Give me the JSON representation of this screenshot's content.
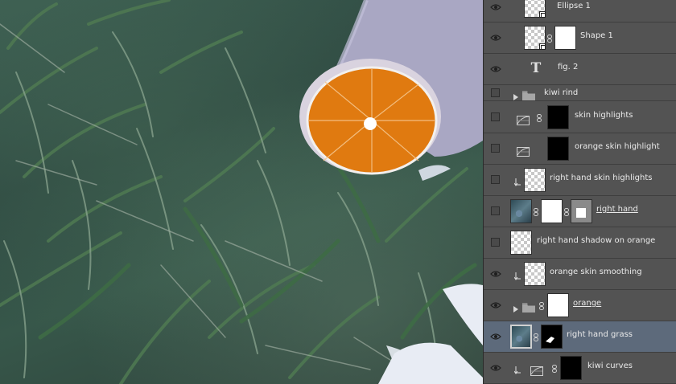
{
  "layers_panel": {
    "layers": [
      {
        "name": "Ellipse 1",
        "visible": true,
        "type": "shape",
        "icon": "shape-thumbnail-icon"
      },
      {
        "name": "Shape 1",
        "visible": true,
        "type": "shape-with-mask",
        "icon": "shape-thumbnail-icon"
      },
      {
        "name": "fig. 2",
        "visible": true,
        "type": "text",
        "icon": "text-layer-icon"
      },
      {
        "name": "kiwi rind",
        "visible": false,
        "type": "group",
        "icon": "folder-icon"
      },
      {
        "name": "skin highlights",
        "visible": false,
        "type": "adjustment",
        "icon": "curves-adjustment-icon"
      },
      {
        "name": "orange skin highlight",
        "visible": false,
        "type": "adjustment",
        "icon": "curves-adjustment-icon"
      },
      {
        "name": "right hand skin highlights",
        "visible": false,
        "type": "clipped-pixel",
        "icon": "clipping-arrow-icon"
      },
      {
        "name": "right hand",
        "visible": false,
        "type": "smart-object-with-masks",
        "icon": "photo-thumbnail-icon"
      },
      {
        "name": "right hand shadow on orange",
        "visible": false,
        "type": "pixel",
        "icon": "checker-thumbnail-icon"
      },
      {
        "name": "orange skin smoothing",
        "visible": true,
        "type": "clipped-pixel",
        "icon": "clipping-arrow-icon"
      },
      {
        "name": "orange",
        "visible": true,
        "type": "group-with-mask",
        "icon": "folder-icon"
      },
      {
        "name": "right hand grass",
        "visible": true,
        "type": "smart-object-with-mask",
        "selected": true,
        "icon": "photo-thumbnail-icon"
      },
      {
        "name": "kiwi curves",
        "visible": true,
        "type": "clipped-adjustment",
        "icon": "curves-adjustment-icon"
      }
    ]
  },
  "colors": {
    "panel_bg": "#535353",
    "selected_row": "#5d6a7b",
    "orange_flesh": "#e07a10"
  }
}
